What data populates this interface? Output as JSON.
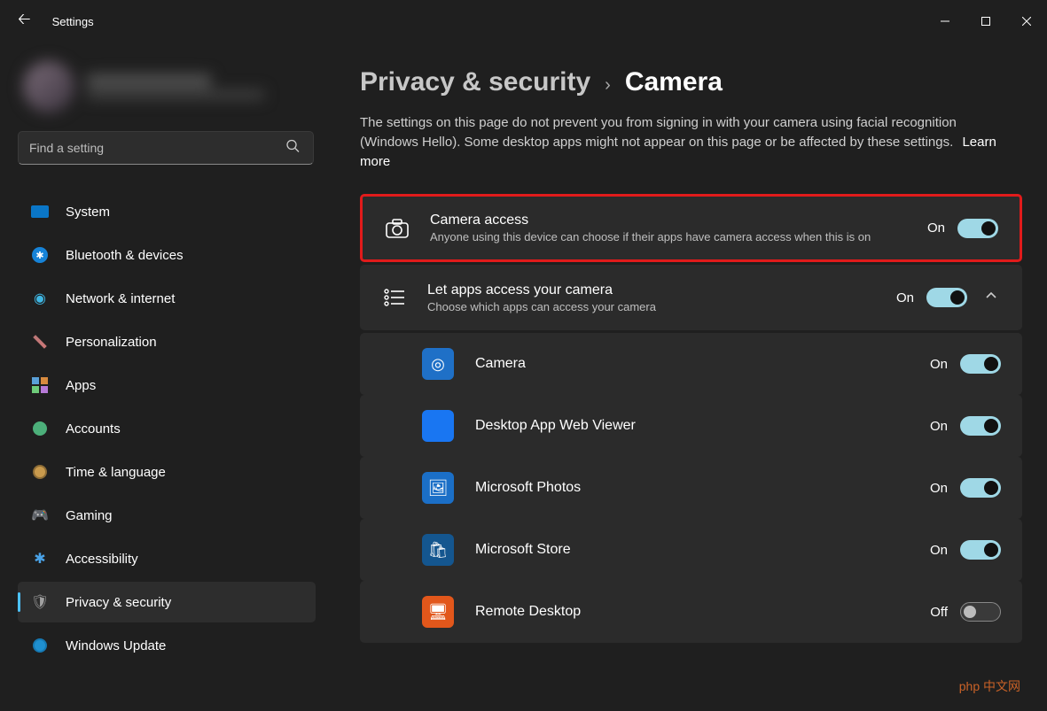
{
  "app_title": "Settings",
  "search": {
    "placeholder": "Find a setting"
  },
  "sidebar": {
    "items": [
      {
        "label": "System"
      },
      {
        "label": "Bluetooth & devices"
      },
      {
        "label": "Network & internet"
      },
      {
        "label": "Personalization"
      },
      {
        "label": "Apps"
      },
      {
        "label": "Accounts"
      },
      {
        "label": "Time & language"
      },
      {
        "label": "Gaming"
      },
      {
        "label": "Accessibility"
      },
      {
        "label": "Privacy & security"
      },
      {
        "label": "Windows Update"
      }
    ]
  },
  "breadcrumb": {
    "parent": "Privacy & security",
    "current": "Camera"
  },
  "description": "The settings on this page do not prevent you from signing in with your camera using facial recognition (Windows Hello). Some desktop apps might not appear on this page or be affected by these settings.",
  "learn_more": "Learn more",
  "rows": {
    "camera_access": {
      "title": "Camera access",
      "sub": "Anyone using this device can choose if their apps have camera access when this is on",
      "state": "On"
    },
    "let_apps": {
      "title": "Let apps access your camera",
      "sub": "Choose which apps can access your camera",
      "state": "On"
    }
  },
  "apps": [
    {
      "label": "Camera",
      "state": "On",
      "on": true,
      "icon_bg": "#1f70c7",
      "glyph": "◎"
    },
    {
      "label": "Desktop App Web Viewer",
      "state": "On",
      "on": true,
      "icon_bg": "#1976f2",
      "glyph": ""
    },
    {
      "label": "Microsoft Photos",
      "state": "On",
      "on": true,
      "icon_bg": "#1b6fc7",
      "glyph": "🖼"
    },
    {
      "label": "Microsoft Store",
      "state": "On",
      "on": true,
      "icon_bg": "#14568f",
      "glyph": "🛍"
    },
    {
      "label": "Remote Desktop",
      "state": "Off",
      "on": false,
      "icon_bg": "#e2571b",
      "glyph": "🖥"
    }
  ],
  "watermark": "php 中文网"
}
